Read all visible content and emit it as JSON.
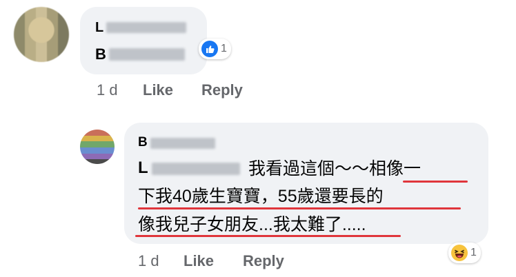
{
  "comment1": {
    "author_initial": "L",
    "text_initial": "B",
    "time": "1 d",
    "like_label": "Like",
    "reply_label": "Reply",
    "reaction_count": "1",
    "reaction_icon": "thumbs-up-icon"
  },
  "comment2": {
    "author_initial": "B",
    "mention_initial": "L",
    "line1": "我看過這個～～相像一",
    "line2": "下我40歲生寶寶，55歲還要長的",
    "line3": "像我兒子女朋友...我太難了.....",
    "time": "1 d",
    "like_label": "Like",
    "reply_label": "Reply",
    "reaction_count": "1",
    "reaction_icon": "haha-icon"
  },
  "colors": {
    "bubble": "#f0f2f5",
    "meta": "#65676b",
    "like_blue": "#1877f2",
    "underline_red": "#e0353b"
  }
}
